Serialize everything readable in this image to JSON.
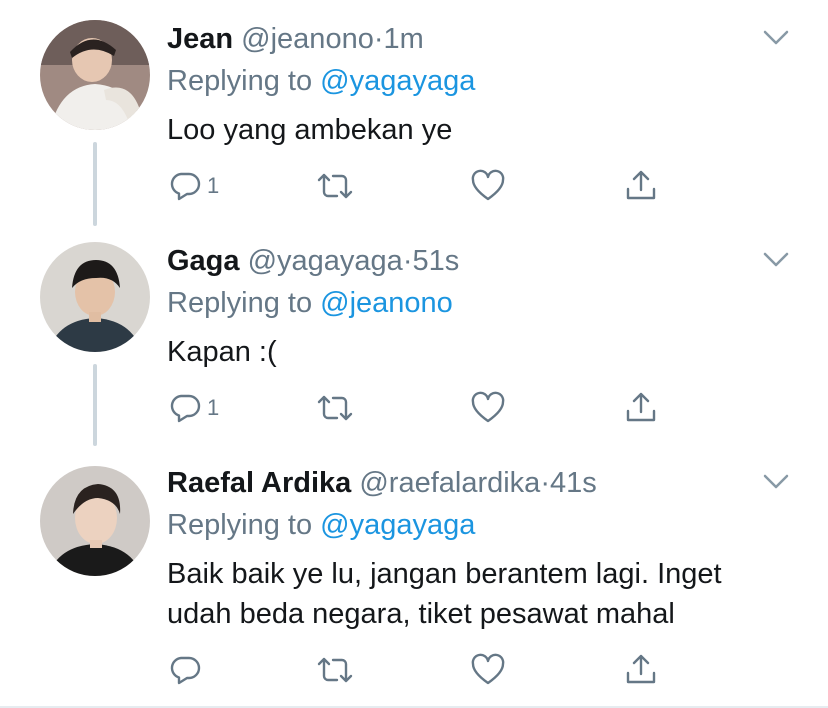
{
  "tweets": [
    {
      "name": "Jean",
      "handle": "@jeanono",
      "dot": "·",
      "time": "1m",
      "replying_prefix": "Replying to",
      "replying_to": "@yagayaga",
      "text": "Loo yang ambekan ye",
      "reply_count": "1"
    },
    {
      "name": "Gaga",
      "handle": "@yagayaga",
      "dot": "·",
      "time": "51s",
      "replying_prefix": "Replying to",
      "replying_to": "@jeanono",
      "text": "Kapan :(",
      "reply_count": "1"
    },
    {
      "name": "Raefal Ardika",
      "handle": "@raefalardika",
      "dot": "·",
      "time": "41s",
      "replying_prefix": "Replying to",
      "replying_to": "@yagayaga",
      "text_line1": "Baik baik ye lu, jangan berantem lagi. Inget",
      "text_line2": "udah beda negara, tiket pesawat mahal",
      "reply_count": ""
    }
  ],
  "icons": {
    "reply": "reply-icon",
    "retweet": "retweet-icon",
    "like": "heart-icon",
    "share": "share-icon",
    "more": "chevron-down-icon"
  },
  "colors": {
    "link": "#1b95e0",
    "secondary": "#657786",
    "thread_line": "#ccd6dd"
  }
}
